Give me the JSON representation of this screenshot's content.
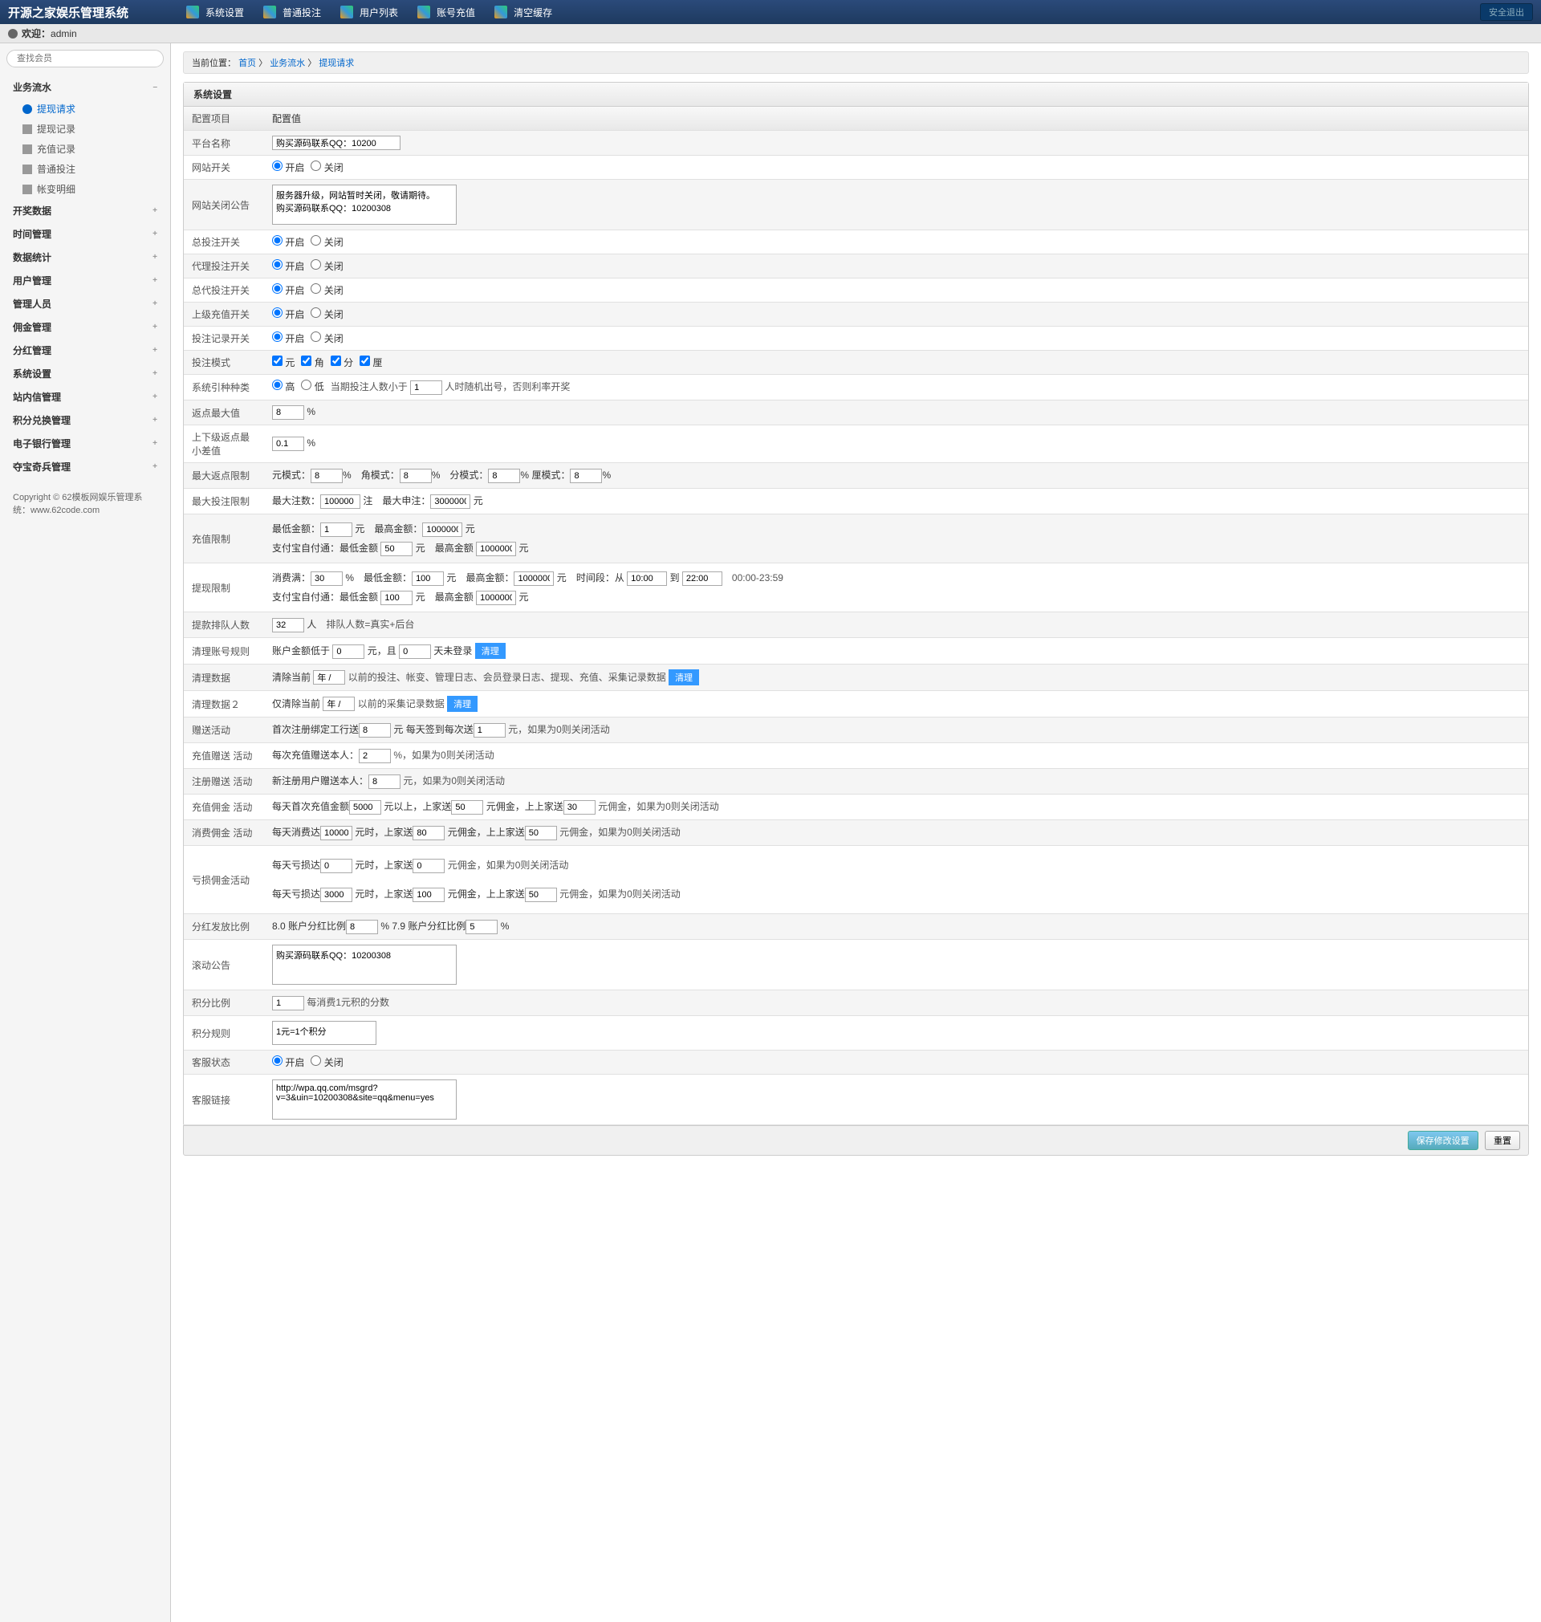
{
  "header": {
    "logo": "开源之家娱乐管理系统",
    "nav": [
      "系统设置",
      "普通投注",
      "用户列表",
      "账号充值",
      "清空缓存"
    ],
    "logout": "安全退出",
    "welcome": "欢迎：",
    "user": "admin"
  },
  "sidebar": {
    "search_placeholder": "查找会员",
    "groups": [
      {
        "title": "业务流水",
        "open": true,
        "items": [
          "提现请求",
          "提现记录",
          "充值记录",
          "普通投注",
          "帐变明细"
        ],
        "active": 0
      },
      {
        "title": "开奖数据"
      },
      {
        "title": "时间管理"
      },
      {
        "title": "数据统计"
      },
      {
        "title": "用户管理"
      },
      {
        "title": "管理人员"
      },
      {
        "title": "佣金管理"
      },
      {
        "title": "分红管理"
      },
      {
        "title": "系统设置"
      },
      {
        "title": "站内信管理"
      },
      {
        "title": "积分兑换管理"
      },
      {
        "title": "电子银行管理"
      },
      {
        "title": "夺宝奇兵管理"
      }
    ],
    "copyright": "Copyright © 62模板网娱乐管理系统：www.62code.com"
  },
  "breadcrumb": {
    "label": "当前位置：",
    "home": "首页",
    "mid": "业务流水",
    "cur": "提现请求"
  },
  "panel_title": "系统设置",
  "table_head": {
    "item": "配置项目",
    "value": "配置值"
  },
  "rows": {
    "platform_name": {
      "label": "平台名称",
      "value": "购买源码联系QQ：10200"
    },
    "site_switch": {
      "label": "网站开关",
      "on": "开启",
      "off": "关闭"
    },
    "close_notice": {
      "label": "网站关闭公告",
      "value": "服务器升级，网站暂时关闭，敬请期待。\n购买源码联系QQ：10200308"
    },
    "total_bet": {
      "label": "总投注开关",
      "on": "开启",
      "off": "关闭"
    },
    "agent_bet": {
      "label": "代理投注开关",
      "on": "开启",
      "off": "关闭"
    },
    "gen_agent_bet": {
      "label": "总代投注开关",
      "on": "开启",
      "off": "关闭"
    },
    "up_recharge": {
      "label": "上级充值开关",
      "on": "开启",
      "off": "关闭"
    },
    "bet_record": {
      "label": "投注记录开关",
      "on": "开启",
      "off": "关闭"
    },
    "bet_mode": {
      "label": "投注模式",
      "yuan": "元",
      "jiao": "角",
      "fen": "分",
      "li": "厘"
    },
    "lottery_type": {
      "label": "系统引种种类",
      "high": "高",
      "low": "低",
      "txt1": "当期投注人数小于",
      "val": "1",
      "txt2": "人时随机出号，否则利率开奖"
    },
    "rebate_max": {
      "label": "返点最大值",
      "val": "8",
      "unit": "%"
    },
    "rebate_min": {
      "label": "上下级返点最小差值",
      "val": "0.1",
      "unit": "%"
    },
    "max_rebate": {
      "label": "最大返点限制",
      "t1": "元模式：",
      "v1": "8",
      "t2": "角模式：",
      "v2": "8",
      "t3": "分模式：",
      "v3": "8",
      "t4": "厘模式：",
      "v4": "8",
      "pct": "%"
    },
    "max_bet": {
      "label": "最大投注限制",
      "t1": "最大注数：",
      "v1": "100000",
      "u1": "注",
      "t2": "最大申注：",
      "v2": "3000000",
      "u2": "元"
    },
    "recharge_limit": {
      "label": "充值限制",
      "r1": "最低金额：",
      "r1v": "1",
      "r2": "最高金额：",
      "r2v": "1000000",
      "u": "元",
      "r3": "支付宝自付通：最低金额",
      "r3v": "50",
      "r4": "最高金额",
      "r4v": "1000000"
    },
    "withdraw_limit": {
      "label": "提现限制",
      "t1": "消费满：",
      "v1": "30",
      "u1": "%",
      "t2": "最低金额：",
      "v2": "100",
      "t3": "最高金额：",
      "v3": "1000000",
      "u": "元",
      "t4": "时间段：从",
      "v4": "10:00",
      "t5": "到",
      "v5": "22:00",
      "hint": "00:00-23:59",
      "t6": "支付宝自付通：最低金额",
      "v6": "100",
      "t7": "最高金额",
      "v7": "1000000"
    },
    "rank_count": {
      "label": "提款排队人数",
      "val": "32",
      "u": "人",
      "txt": "排队人数=真实+后台"
    },
    "clear_acc": {
      "label": "清理账号规则",
      "t1": "账户金额低于",
      "v1": "0",
      "u1": "元，且",
      "v2": "0",
      "t2": "天未登录",
      "btn": "清理"
    },
    "clear_data": {
      "label": "清理数据",
      "t1": "清除当前",
      "v1": "年 /",
      "t2": "以前的投注、帐变、管理日志、会员登录日志、提现、充值、采集记录数据",
      "btn": "清理"
    },
    "clear_data2": {
      "label": "清理数据２",
      "t1": "仅清除当前",
      "v1": "年 /",
      "t2": "以前的采集记录数据",
      "btn": "清理"
    },
    "gift_act": {
      "label": "赠送活动",
      "t1": "首次注册绑定工行送",
      "v1": "8",
      "u": "元",
      "t2": "每天签到每次送",
      "v2": "1",
      "t3": "元，如果为0则关闭活动"
    },
    "recharge_gift": {
      "label": "充值赠送 活动",
      "t1": "每次充值赠送本人：",
      "v1": "2",
      "t2": "%，如果为0则关闭活动"
    },
    "reg_gift": {
      "label": "注册赠送 活动",
      "t1": "新注册用户赠送本人：",
      "v1": "8",
      "t2": "元，如果为0则关闭活动"
    },
    "recharge_comm": {
      "label": "充值佣金 活动",
      "t1": "每天首次充值金额",
      "v1": "5000",
      "t2": "元以上，上家送",
      "v2": "50",
      "t3": "元佣金，上上家送",
      "v3": "30",
      "t4": "元佣金，如果为0则关闭活动"
    },
    "consume_comm": {
      "label": "消费佣金 活动",
      "t1": "每天消费达",
      "v1": "10000",
      "t2": "元时，上家送",
      "v2": "80",
      "t3": "元佣金，上上家送",
      "v3": "50",
      "t4": "元佣金，如果为0则关闭活动"
    },
    "loss_comm": {
      "label": "亏损佣金活动",
      "r1t1": "每天亏损达",
      "r1v1": "0",
      "r1t2": "元时，上家送",
      "r1v2": "0",
      "r1t3": "元佣金，如果为0则关闭活动",
      "r2t1": "每天亏损达",
      "r2v1": "3000",
      "r2t2": "元时，上家送",
      "r2v2": "100",
      "r2t3": "元佣金，上上家送",
      "r2v3": "50",
      "r2t4": "元佣金，如果为0则关闭活动"
    },
    "bonus_ratio": {
      "label": "分红发放比例",
      "t1": "8.0 账户分红比例",
      "v1": "8",
      "t2": "% 7.9 账户分红比例",
      "v2": "5",
      "u": "%"
    },
    "scroll_notice": {
      "label": "滚动公告",
      "value": "购买源码联系QQ：10200308"
    },
    "point_ratio": {
      "label": "积分比例",
      "val": "1",
      "txt": "每消费1元积的分数"
    },
    "point_rule": {
      "label": "积分规则",
      "value": "1元=1个积分"
    },
    "cs_status": {
      "label": "客服状态",
      "on": "开启",
      "off": "关闭"
    },
    "cs_link": {
      "label": "客服链接",
      "value": "http://wpa.qq.com/msgrd?v=3&uin=10200308&site=qq&menu=yes"
    }
  },
  "actions": {
    "save": "保存修改设置",
    "reset": "重置"
  }
}
